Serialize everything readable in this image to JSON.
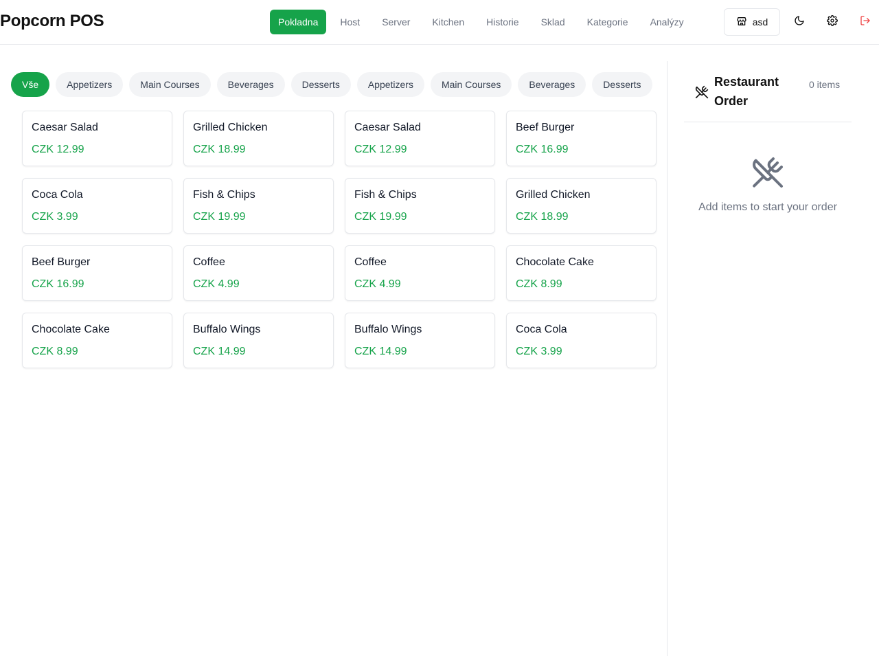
{
  "app": {
    "title": "Popcorn POS"
  },
  "nav": {
    "items": [
      {
        "label": "Pokladna",
        "active": true
      },
      {
        "label": "Host"
      },
      {
        "label": "Server"
      },
      {
        "label": "Kitchen"
      },
      {
        "label": "Historie"
      },
      {
        "label": "Sklad"
      },
      {
        "label": "Kategorie"
      },
      {
        "label": "Analýzy"
      }
    ]
  },
  "toolbar": {
    "store_label": "asd",
    "icons": [
      "store-icon",
      "moon-icon",
      "gear-icon",
      "logout-icon"
    ]
  },
  "categories": [
    {
      "label": "Vše",
      "active": true
    },
    {
      "label": "Appetizers"
    },
    {
      "label": "Main Courses"
    },
    {
      "label": "Beverages"
    },
    {
      "label": "Desserts"
    },
    {
      "label": "Appetizers"
    },
    {
      "label": "Main Courses"
    },
    {
      "label": "Beverages"
    },
    {
      "label": "Desserts"
    }
  ],
  "products": [
    {
      "name": "Caesar Salad",
      "price": "CZK 12.99"
    },
    {
      "name": "Grilled Chicken",
      "price": "CZK 18.99"
    },
    {
      "name": "Caesar Salad",
      "price": "CZK 12.99"
    },
    {
      "name": "Beef Burger",
      "price": "CZK 16.99"
    },
    {
      "name": "Coca Cola",
      "price": "CZK 3.99"
    },
    {
      "name": "Fish & Chips",
      "price": "CZK 19.99"
    },
    {
      "name": "Fish & Chips",
      "price": "CZK 19.99"
    },
    {
      "name": "Grilled Chicken",
      "price": "CZK 18.99"
    },
    {
      "name": "Beef Burger",
      "price": "CZK 16.99"
    },
    {
      "name": "Coffee",
      "price": "CZK 4.99"
    },
    {
      "name": "Coffee",
      "price": "CZK 4.99"
    },
    {
      "name": "Chocolate Cake",
      "price": "CZK 8.99"
    },
    {
      "name": "Chocolate Cake",
      "price": "CZK 8.99"
    },
    {
      "name": "Buffalo Wings",
      "price": "CZK 14.99"
    },
    {
      "name": "Buffalo Wings",
      "price": "CZK 14.99"
    },
    {
      "name": "Coca Cola",
      "price": "CZK 3.99"
    }
  ],
  "order": {
    "title": "Restaurant Order",
    "count": "0 items",
    "empty_message": "Add items to start your order",
    "icon": "utensils-crossed-icon"
  },
  "colors": {
    "accent": "#16a34a",
    "danger": "#ef4444",
    "muted": "#6b7280",
    "border": "#e5e7eb"
  }
}
